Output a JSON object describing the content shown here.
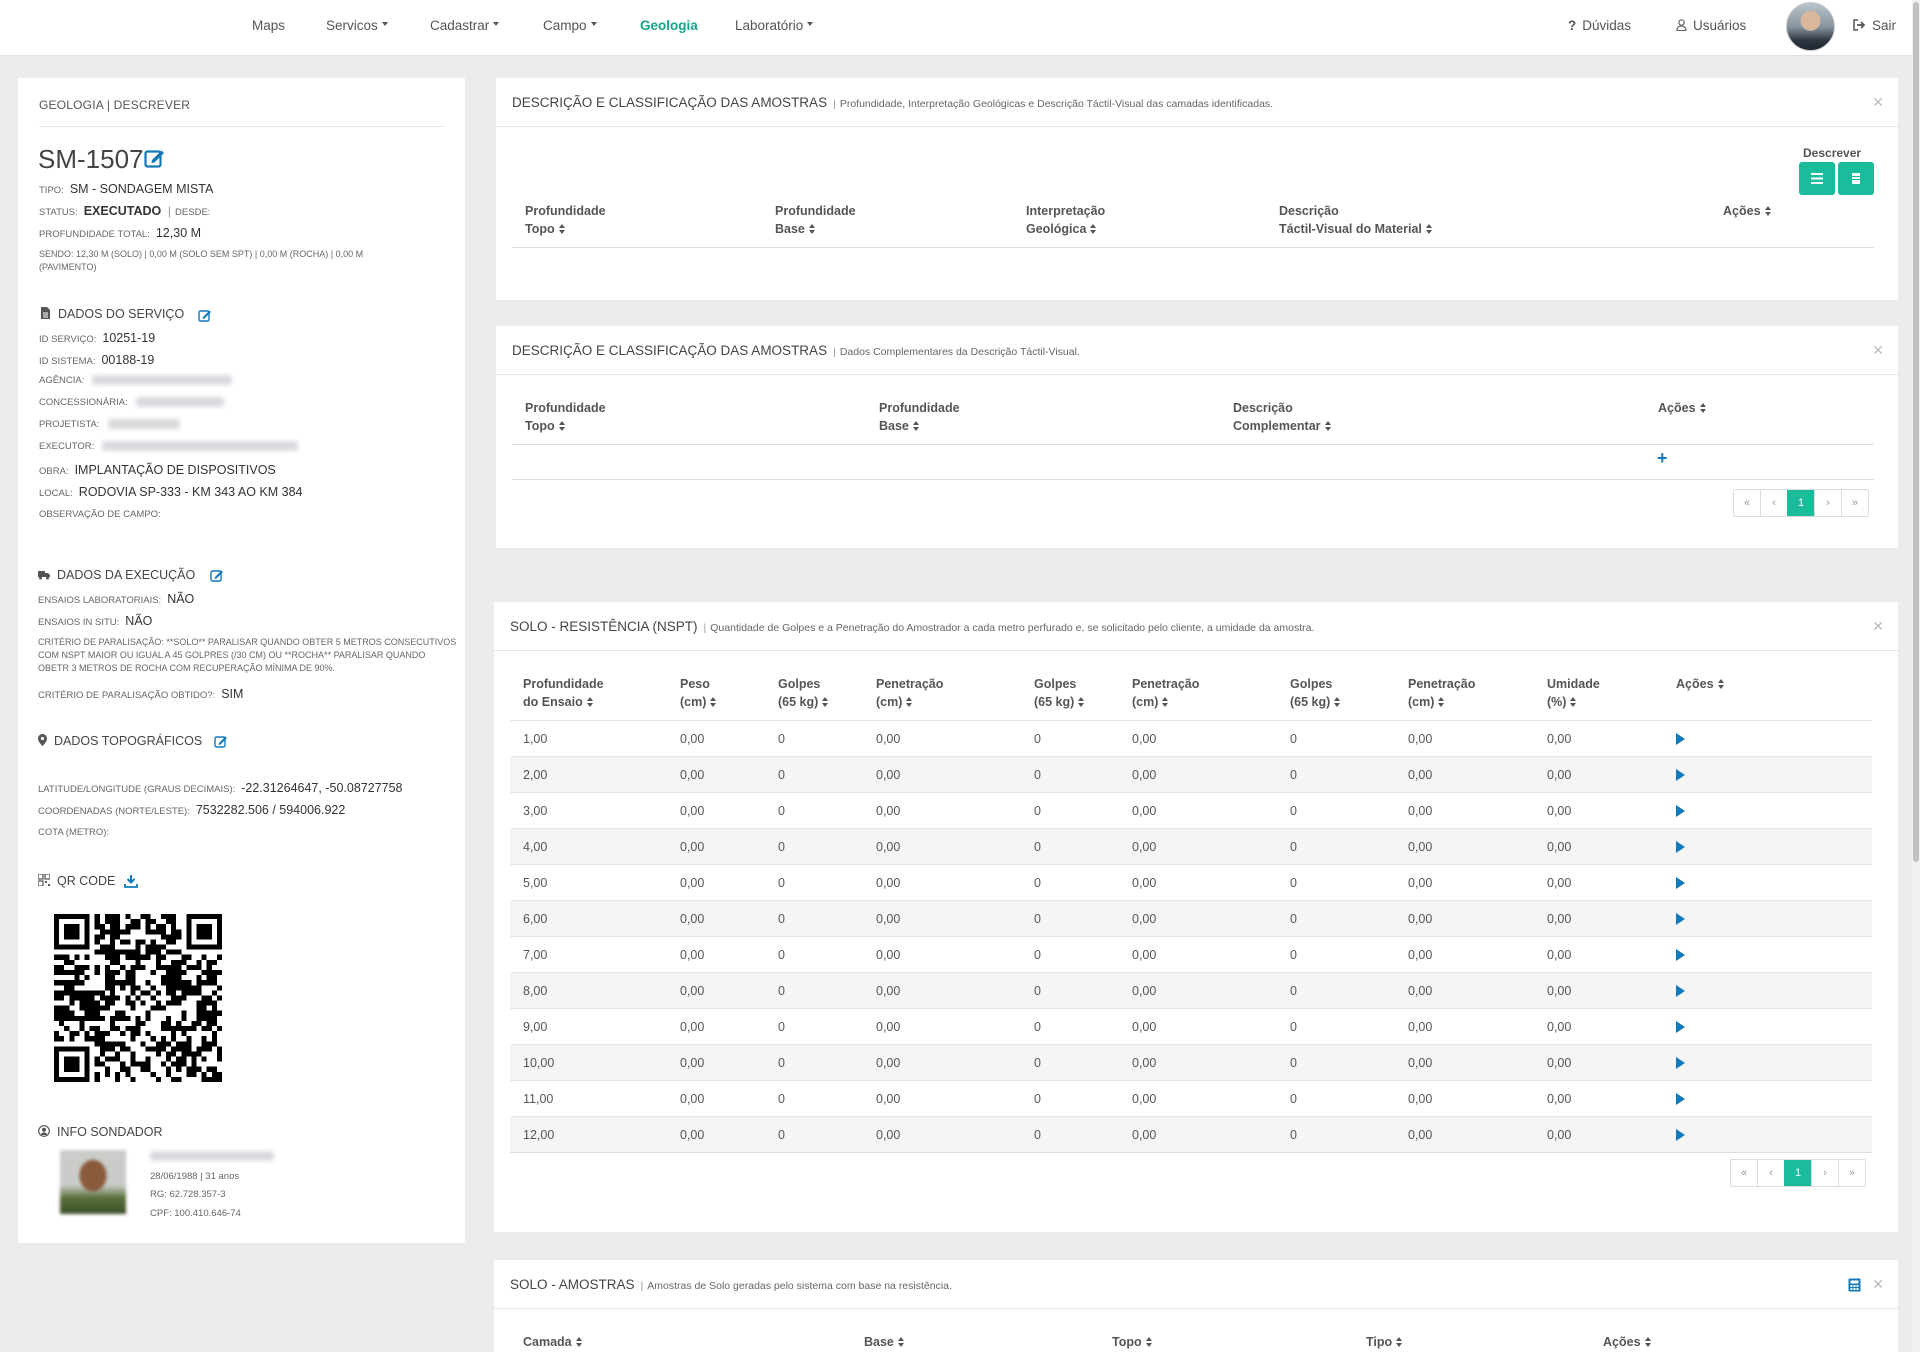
{
  "nav": {
    "items": [
      {
        "label": "Maps"
      },
      {
        "label": "Servicos"
      },
      {
        "label": "Cadastrar"
      },
      {
        "label": "Campo"
      },
      {
        "label": "Geologia"
      },
      {
        "label": "Laboratório"
      }
    ],
    "help_label": "Dúvidas",
    "users_label": "Usuários",
    "logout_label": "Sair"
  },
  "sidebar": {
    "breadcrumb": "GEOLOGIA | DESCREVER",
    "code": "SM-1507",
    "tipo_label": "TIPO:",
    "tipo_value": "SM - SONDAGEM MISTA",
    "status_label": "STATUS:",
    "status_value": "EXECUTADO",
    "status_sep": "|",
    "desde_label": "DESDE:",
    "prof_label": "PROFUNDIDADE TOTAL:",
    "prof_value": "12,30 M",
    "sendo_text": "SENDO: 12,30 M (SOLO) | 0,00 M (SOLO SEM SPT) | 0,00 M (ROCHA) | 0,00 M (PAVIMENTO)",
    "servico": {
      "title": "DADOS DO SERVIÇO",
      "id_servico_label": "ID SERVIÇO:",
      "id_servico": "10251-19",
      "id_sistema_label": "ID SISTEMA:",
      "id_sistema": "00188-19",
      "agencia_label": "AGÊNCIA:",
      "concessionaria_label": "CONCESSIONÁRIA:",
      "projetista_label": "PROJETISTA:",
      "executor_label": "EXECUTOR:",
      "obra_label": "OBRA:",
      "obra": "IMPLANTAÇÃO DE DISPOSITIVOS",
      "local_label": "LOCAL:",
      "local": "RODOVIA SP-333 - KM 343 AO KM 384",
      "obs_label": "OBSERVAÇÃO DE CAMPO:"
    },
    "execucao": {
      "title": "DADOS DA EXECUÇÃO",
      "lab_label": "ENSAIOS LABORATORIAIS:",
      "lab": "NÃO",
      "situ_label": "ENSAIOS IN SITU:",
      "situ": "NÃO",
      "criterio_text": "CRITÉRIO DE PARALISAÇÃO: **SOLO** PARALISAR QUANDO OBTER 5 METROS CONSECUTIVOS COM NSPT MAIOR OU IGUAL A 45 GOLPRES (/30 CM) OU **ROCHA** PARALISAR QUANDO OBETR 3 METROS DE ROCHA COM RECUPERAÇÃO MÍNIMA DE 90%.",
      "obtido_label": "CRITÉRIO DE PARALISAÇÃO OBTIDO?:",
      "obtido": "SIM"
    },
    "topo": {
      "title": "DADOS TOPOGRÁFICOS",
      "latlon_label": "LATITUDE/LONGITUDE (GRAUS DECIMAIS):",
      "latlon": "-22.31264647, -50.08727758",
      "coord_label": "COORDENADAS (NORTE/LESTE):",
      "coord": "7532282.506 / 594006.922",
      "cota_label": "COTA (METRO):"
    },
    "qr_title": "QR CODE",
    "sondador": {
      "title": "INFO SONDADOR",
      "birth": "28/06/1988 | 31 anos",
      "rg": "RG: 62.728.357-3",
      "cpf": "CPF: 100.410.646-74"
    }
  },
  "panel1": {
    "title": "DESCRIÇÃO E CLASSIFICAÇÃO DAS AMOSTRAS",
    "subtitle": "Profundidade, Interpretação Geológicas e Descrição Táctil-Visual das camadas identificadas.",
    "descrever_label": "Descrever",
    "columns": [
      {
        "l1": "Profundidade",
        "l2": "Topo"
      },
      {
        "l1": "Profundidade",
        "l2": "Base"
      },
      {
        "l1": "Interpretação",
        "l2": "Geológica"
      },
      {
        "l1": "Descrição",
        "l2": "Táctil-Visual do Material"
      },
      {
        "l1": "Ações",
        "l2": ""
      }
    ]
  },
  "panel2": {
    "title": "DESCRIÇÃO E CLASSIFICAÇÃO DAS AMOSTRAS",
    "subtitle": "Dados Complementares da Descrição Táctil-Visual.",
    "columns": [
      {
        "l1": "Profundidade",
        "l2": "Topo"
      },
      {
        "l1": "Profundidade",
        "l2": "Base"
      },
      {
        "l1": "Descrição",
        "l2": "Complementar"
      },
      {
        "l1": "Ações",
        "l2": ""
      }
    ],
    "add_label": "+",
    "pager": [
      "«",
      "‹",
      "1",
      "›",
      "»"
    ]
  },
  "panel3": {
    "title": "SOLO - RESISTÊNCIA (NSPT)",
    "subtitle": "Quantidade de Golpes e a Penetração do Amostrador a cada metro perfurado e, se solicitado pelo cliente, a umidade da amostra.",
    "columns": [
      {
        "l1": "Profundidade",
        "l2": "do Ensaio"
      },
      {
        "l1": "Peso",
        "l2": "(cm)"
      },
      {
        "l1": "Golpes",
        "l2": "(65 kg)"
      },
      {
        "l1": "Penetração",
        "l2": "(cm)"
      },
      {
        "l1": "Golpes",
        "l2": "(65 kg)"
      },
      {
        "l1": "Penetração",
        "l2": "(cm)"
      },
      {
        "l1": "Golpes",
        "l2": "(65 kg)"
      },
      {
        "l1": "Penetração",
        "l2": "(cm)"
      },
      {
        "l1": "Umidade",
        "l2": "(%)"
      },
      {
        "l1": "Ações",
        "l2": ""
      }
    ],
    "rows": [
      [
        "1,00",
        "0,00",
        "0",
        "0,00",
        "0",
        "0,00",
        "0",
        "0,00",
        "0,00"
      ],
      [
        "2,00",
        "0,00",
        "0",
        "0,00",
        "0",
        "0,00",
        "0",
        "0,00",
        "0,00"
      ],
      [
        "3,00",
        "0,00",
        "0",
        "0,00",
        "0",
        "0,00",
        "0",
        "0,00",
        "0,00"
      ],
      [
        "4,00",
        "0,00",
        "0",
        "0,00",
        "0",
        "0,00",
        "0",
        "0,00",
        "0,00"
      ],
      [
        "5,00",
        "0,00",
        "0",
        "0,00",
        "0",
        "0,00",
        "0",
        "0,00",
        "0,00"
      ],
      [
        "6,00",
        "0,00",
        "0",
        "0,00",
        "0",
        "0,00",
        "0",
        "0,00",
        "0,00"
      ],
      [
        "7,00",
        "0,00",
        "0",
        "0,00",
        "0",
        "0,00",
        "0",
        "0,00",
        "0,00"
      ],
      [
        "8,00",
        "0,00",
        "0",
        "0,00",
        "0",
        "0,00",
        "0",
        "0,00",
        "0,00"
      ],
      [
        "9,00",
        "0,00",
        "0",
        "0,00",
        "0",
        "0,00",
        "0",
        "0,00",
        "0,00"
      ],
      [
        "10,00",
        "0,00",
        "0",
        "0,00",
        "0",
        "0,00",
        "0",
        "0,00",
        "0,00"
      ],
      [
        "11,00",
        "0,00",
        "0",
        "0,00",
        "0",
        "0,00",
        "0",
        "0,00",
        "0,00"
      ],
      [
        "12,00",
        "0,00",
        "0",
        "0,00",
        "0",
        "0,00",
        "0",
        "0,00",
        "0,00"
      ]
    ],
    "pager": [
      "«",
      "‹",
      "1",
      "›",
      "»"
    ]
  },
  "panel4": {
    "title": "SOLO - AMOSTRAS",
    "subtitle": "Amostras de Solo geradas pelo sistema com base na resistência.",
    "columns": [
      {
        "l1": "Camada"
      },
      {
        "l1": "Base"
      },
      {
        "l1": "Topo"
      },
      {
        "l1": "Tipo"
      },
      {
        "l1": "Ações"
      }
    ]
  },
  "colors": {
    "accent": "#1abc9c",
    "active_nav": "#17a589",
    "play": "#1479b8",
    "edit": "#1479b8"
  }
}
